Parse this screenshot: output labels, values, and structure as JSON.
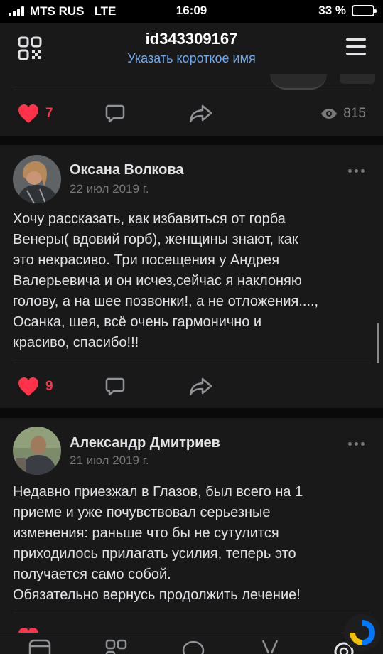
{
  "status_bar": {
    "carrier": "MTS RUS",
    "network": "LTE",
    "time": "16:09",
    "battery": "33 %",
    "battery_level": 0.33
  },
  "header": {
    "title": "id343309167",
    "subtitle": "Указать короткое имя"
  },
  "prev_post": {
    "likes": "7",
    "views": "815"
  },
  "posts": [
    {
      "author": "Оксана Волкова",
      "date": "22 июл 2019 г.",
      "text": "Хочу рассказать, как избавиться от горба\nВенеры( вдовий горб), женщины знают, как\nэто некрасиво. Три посещения у Андрея\nВалерьевича и он исчез,сейчас я наклоняю\nголову, а на шее позвонки!, а не отложения....,\nОсанка, шея, всё очень гармонично и\nкрасиво, спасибо!!!",
      "likes": "9"
    },
    {
      "author": "Александр Дмитриев",
      "date": "21 июл 2019 г.",
      "text": "Недавно приезжал в Глазов, был всего на 1\nприеме и уже почувствовал серьезные\nизменения: раньше что бы не сутулится\nприходилось прилагать усилия, теперь это\nполучается само собой.\nОбязательно вернусь продолжить лечение!"
    }
  ],
  "colors": {
    "accent": "#71aaeb",
    "like": "#ff3347",
    "background": "#0a0a0a",
    "card": "#191919"
  },
  "icons": {
    "qr": "qr-code-icon",
    "menu": "hamburger-menu-icon",
    "like": "heart-icon",
    "comment": "comment-icon",
    "share": "share-icon",
    "views": "eye-icon",
    "more": "more-dots-icon"
  }
}
